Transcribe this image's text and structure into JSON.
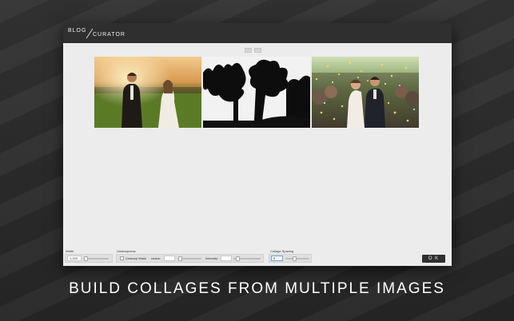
{
  "app": {
    "logo_top": "BLOG",
    "logo_bottom": "CURATOR"
  },
  "controls": {
    "width": {
      "label": "Width",
      "value": "1,200"
    },
    "unsharpness": {
      "group_label": "Unsharpness",
      "checkbox_label": "Unsharp Mask",
      "checked": false,
      "radius_label": "radius:",
      "radius_value": "",
      "intensity_label": "Intensity:",
      "intensity_value": ""
    },
    "collage_spacing": {
      "label": "Collage Spacing",
      "value": "8"
    },
    "ok_label": "O K"
  },
  "caption": "BUILD COLLAGES FROM MULTIPLE IMAGES",
  "colors": {
    "titlebar": "#2f2f2f",
    "window_bg": "#ececec",
    "ok_button": "#2f2f2f",
    "page_bg": "#2b2b2b"
  }
}
